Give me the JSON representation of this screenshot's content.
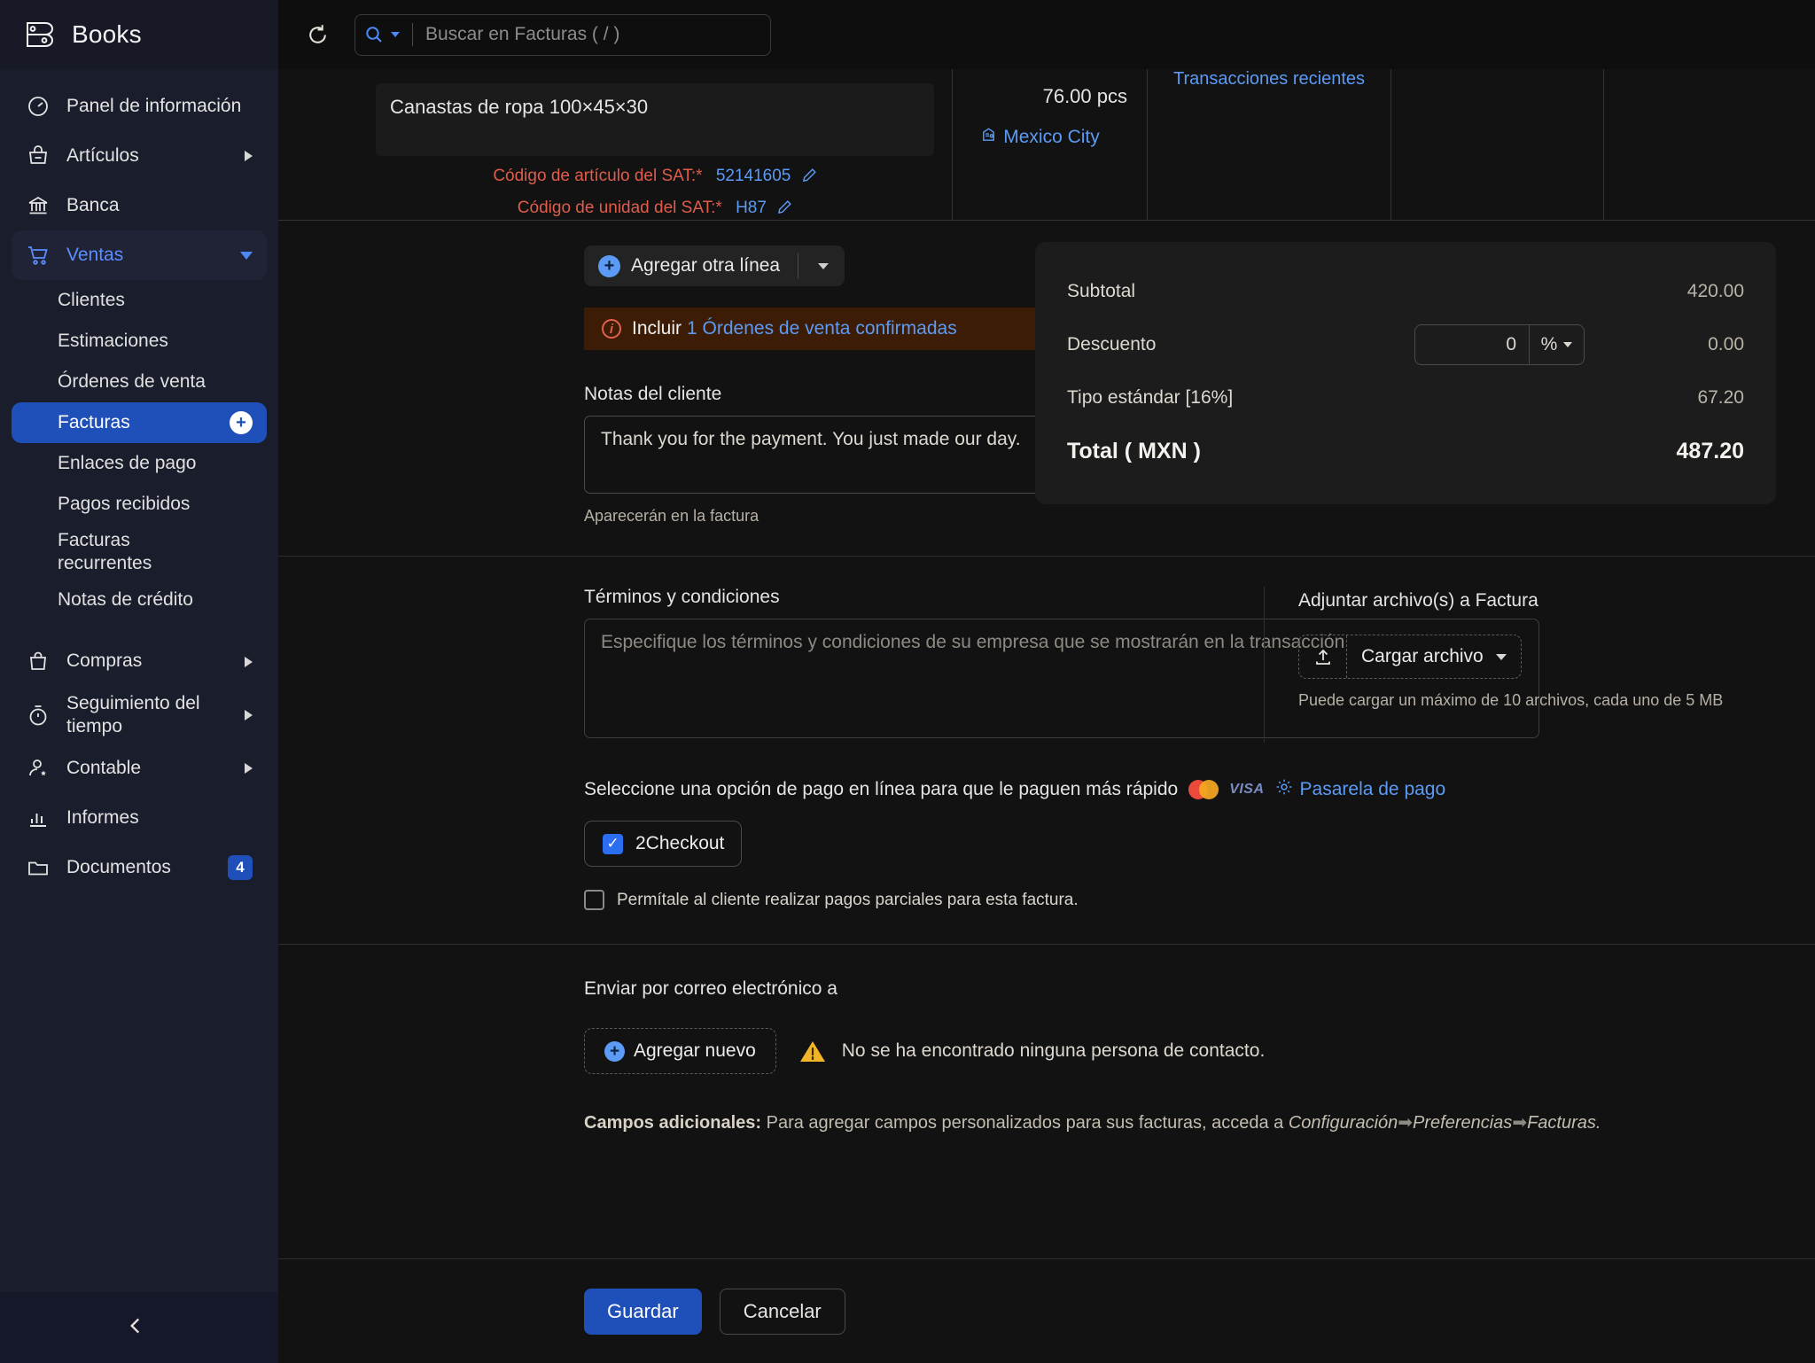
{
  "brand": {
    "name": "Books",
    "logo_icon": "books-logo-icon"
  },
  "sidebar": {
    "items": [
      {
        "label": "Panel de información",
        "icon": "dashboard-gauge-icon",
        "has_caret": false
      },
      {
        "label": "Artículos",
        "icon": "items-bag-icon",
        "has_caret": true
      },
      {
        "label": "Banca",
        "icon": "bank-icon",
        "has_caret": false
      },
      {
        "label": "Ventas",
        "icon": "sales-cart-icon",
        "has_caret": true,
        "expanded": true
      }
    ],
    "sales_children": [
      {
        "label": "Clientes"
      },
      {
        "label": "Estimaciones"
      },
      {
        "label": "Órdenes de venta"
      },
      {
        "label": "Facturas",
        "active": true,
        "plus": "+"
      },
      {
        "label": "Enlaces de pago"
      },
      {
        "label": "Pagos recibidos"
      },
      {
        "label": "Facturas recurrentes"
      },
      {
        "label": "Notas de crédito"
      }
    ],
    "items_after": [
      {
        "label": "Compras",
        "icon": "purchases-bag-icon",
        "has_caret": true
      },
      {
        "label": "Seguimiento del tiempo",
        "icon": "timer-icon",
        "has_caret": true
      },
      {
        "label": "Contable",
        "icon": "accountant-icon",
        "has_caret": true
      },
      {
        "label": "Informes",
        "icon": "reports-chart-icon",
        "has_caret": false
      },
      {
        "label": "Documentos",
        "icon": "documents-folder-icon",
        "has_caret": false,
        "badge": "4"
      }
    ],
    "collapse_icon": "chevron-left-icon"
  },
  "topbar": {
    "refresh_icon": "refresh-icon",
    "search_icon": "search-icon",
    "search_placeholder": "Buscar en Facturas ( / )",
    "search_value": ""
  },
  "line_item": {
    "description": "Canastas de ropa 100×45×30",
    "sat_article_label": "Código de artículo del SAT:*",
    "sat_article_value": "52141605",
    "sat_unit_label": "Código de unidad del SAT:*",
    "sat_unit_value": "H87",
    "quantity": "76.00 pcs",
    "city": "Mexico City",
    "city_icon": "warehouse-icon",
    "recent_transactions": "Transacciones recientes",
    "edit_icon": "pencil-icon"
  },
  "actions": {
    "add_line_label": "Agregar otra línea",
    "add_line_icon": "plus-circle-icon"
  },
  "include_banner": {
    "info_icon": "info-circle-icon",
    "prefix": "Incluir ",
    "link": "1 Órdenes de venta confirmadas"
  },
  "customer_notes": {
    "label": "Notas del cliente",
    "value": "Thank you for the payment. You just made our day.",
    "hint": "Aparecerán en la factura"
  },
  "totals": {
    "subtotal_label": "Subtotal",
    "subtotal_value": "420.00",
    "discount_label": "Descuento",
    "discount_input": "0",
    "discount_unit": "%",
    "discount_value": "0.00",
    "tax_label": "Tipo estándar [16%]",
    "tax_value": "67.20",
    "total_label": "Total ( MXN )",
    "total_value": "487.20"
  },
  "terms": {
    "label": "Términos y condiciones",
    "value": "",
    "placeholder": "Especifique los términos y condiciones de su empresa que se mostrarán en la transacción"
  },
  "attachments": {
    "label": "Adjuntar archivo(s) a Factura",
    "upload_label": "Cargar archivo",
    "upload_icon": "upload-icon",
    "hint": "Puede cargar un máximo de 10 archivos, cada uno de 5 MB"
  },
  "payment": {
    "headline": "Seleccione una opción de pago en línea para que le paguen más rápido",
    "mastercard_icon": "mastercard-icon",
    "visa_icon": "visa-icon",
    "gateway_link": "Pasarela de pago",
    "gateway_icon": "gear-icon",
    "gateway_name": "2Checkout",
    "gateway_checked": true,
    "partial_label": "Permítale al cliente realizar pagos parciales para esta factura.",
    "partial_checked": false
  },
  "email": {
    "label": "Enviar por correo electrónico a",
    "add_new_label": "Agregar nuevo",
    "add_new_icon": "plus-circle-icon",
    "warning_icon": "warning-triangle-icon",
    "warning_text": "No se ha encontrado ninguna persona de contacto."
  },
  "additional_fields": {
    "bold_prefix": "Campos adicionales:",
    "text": " Para agregar campos personalizados para sus facturas, acceda a ",
    "path_1": "Configuración",
    "path_2": "Preferencias",
    "path_3": "Facturas.",
    "arrow": "➡"
  },
  "footer": {
    "save_label": "Guardar",
    "cancel_label": "Cancelar"
  },
  "colors": {
    "accent": "#1f4fb8",
    "link": "#5b9bf5",
    "warning_bg": "#3c1c05",
    "required": "#e05c4b"
  }
}
